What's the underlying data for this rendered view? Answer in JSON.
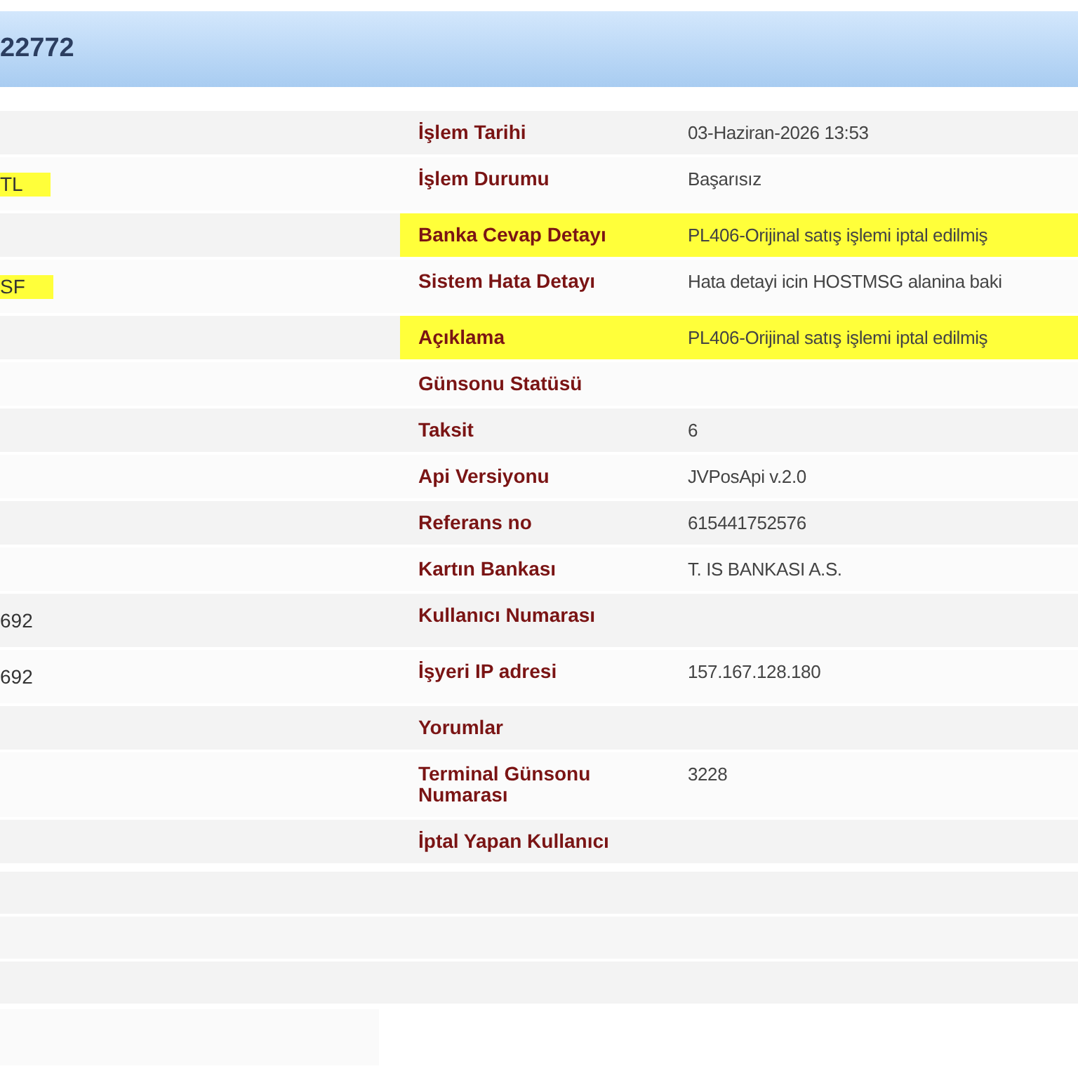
{
  "header": {
    "title": "22772"
  },
  "rows": [
    {
      "label": "İşlem Tarihi",
      "value": "03-Haziran-2026 13:53",
      "highlighted": false
    },
    {
      "left": {
        "value": "TL",
        "highlighted": true
      },
      "label": "İşlem Durumu",
      "value": "Başarısız",
      "highlighted": false
    },
    {
      "label": "Banka Cevap Detayı",
      "value": "PL406-Orijinal satış işlemi iptal edilmiş",
      "highlighted": true
    },
    {
      "left": {
        "value": "SF",
        "highlighted": true
      },
      "label": "Sistem Hata Detayı",
      "value": "Hata detayi icin HOSTMSG alanina baki",
      "highlighted": false
    },
    {
      "label": "Açıklama",
      "value": "PL406-Orijinal satış işlemi iptal edilmiş",
      "highlighted": true
    },
    {
      "label": "Günsonu Statüsü",
      "highlighted": false
    },
    {
      "label": "Taksit",
      "value": "6",
      "highlighted": false
    },
    {
      "label": "Api Versiyonu",
      "value": "JVPosApi v.2.0",
      "highlighted": false
    },
    {
      "label": "Referans no",
      "value": "615441752576",
      "highlighted": false
    },
    {
      "label": "Kartın Bankası",
      "value": "T. IS BANKASI A.S.",
      "highlighted": false
    },
    {
      "left": {
        "value": "692",
        "highlighted": false
      },
      "label": "Kullanıcı Numarası",
      "highlighted": false
    },
    {
      "left": {
        "value": "692",
        "highlighted": false
      },
      "label": "İşyeri IP adresi",
      "value": "157.167.128.180",
      "highlighted": false
    },
    {
      "label": "Yorumlar",
      "highlighted": false
    },
    {
      "label": "Terminal Günsonu Numarası",
      "value": "3228",
      "highlighted": false
    },
    {
      "label": "İptal Yapan Kullanıcı",
      "highlighted": false
    }
  ]
}
